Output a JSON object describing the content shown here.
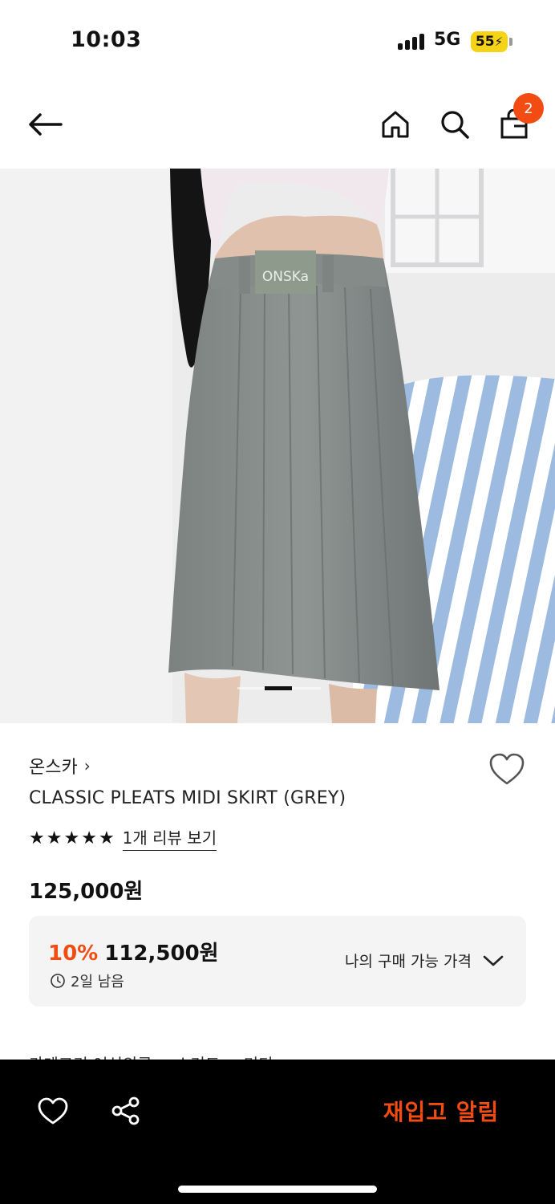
{
  "status_bar": {
    "time": "10:03",
    "network": "5G",
    "battery": "55"
  },
  "header": {
    "icons": [
      "back-arrow-icon",
      "home-icon",
      "search-icon",
      "shopping-bag-icon"
    ],
    "cart_count": "2"
  },
  "product_image": {
    "logo_tag_text": "ONSKa"
  },
  "product": {
    "brand": "온스카",
    "name": "CLASSIC PLEATS MIDI SKIRT (GREY)",
    "rating_stars": 5,
    "review_link": "1개 리뷰 보기",
    "original_price": "125,000원",
    "discount_rate": "10%",
    "discount_price": "112,500원",
    "time_left": "2일 남음",
    "my_price_label": "나의 구매 가능 가격"
  },
  "category_peek": "카테고리     여성의류 > 스커트 > 미디",
  "bottom_bar": {
    "restock_label": "재입고 알림"
  },
  "colors": {
    "accent": "#f24c13",
    "bottom_bar_bg": "#000000",
    "price_box_bg": "#f4f4f5"
  }
}
